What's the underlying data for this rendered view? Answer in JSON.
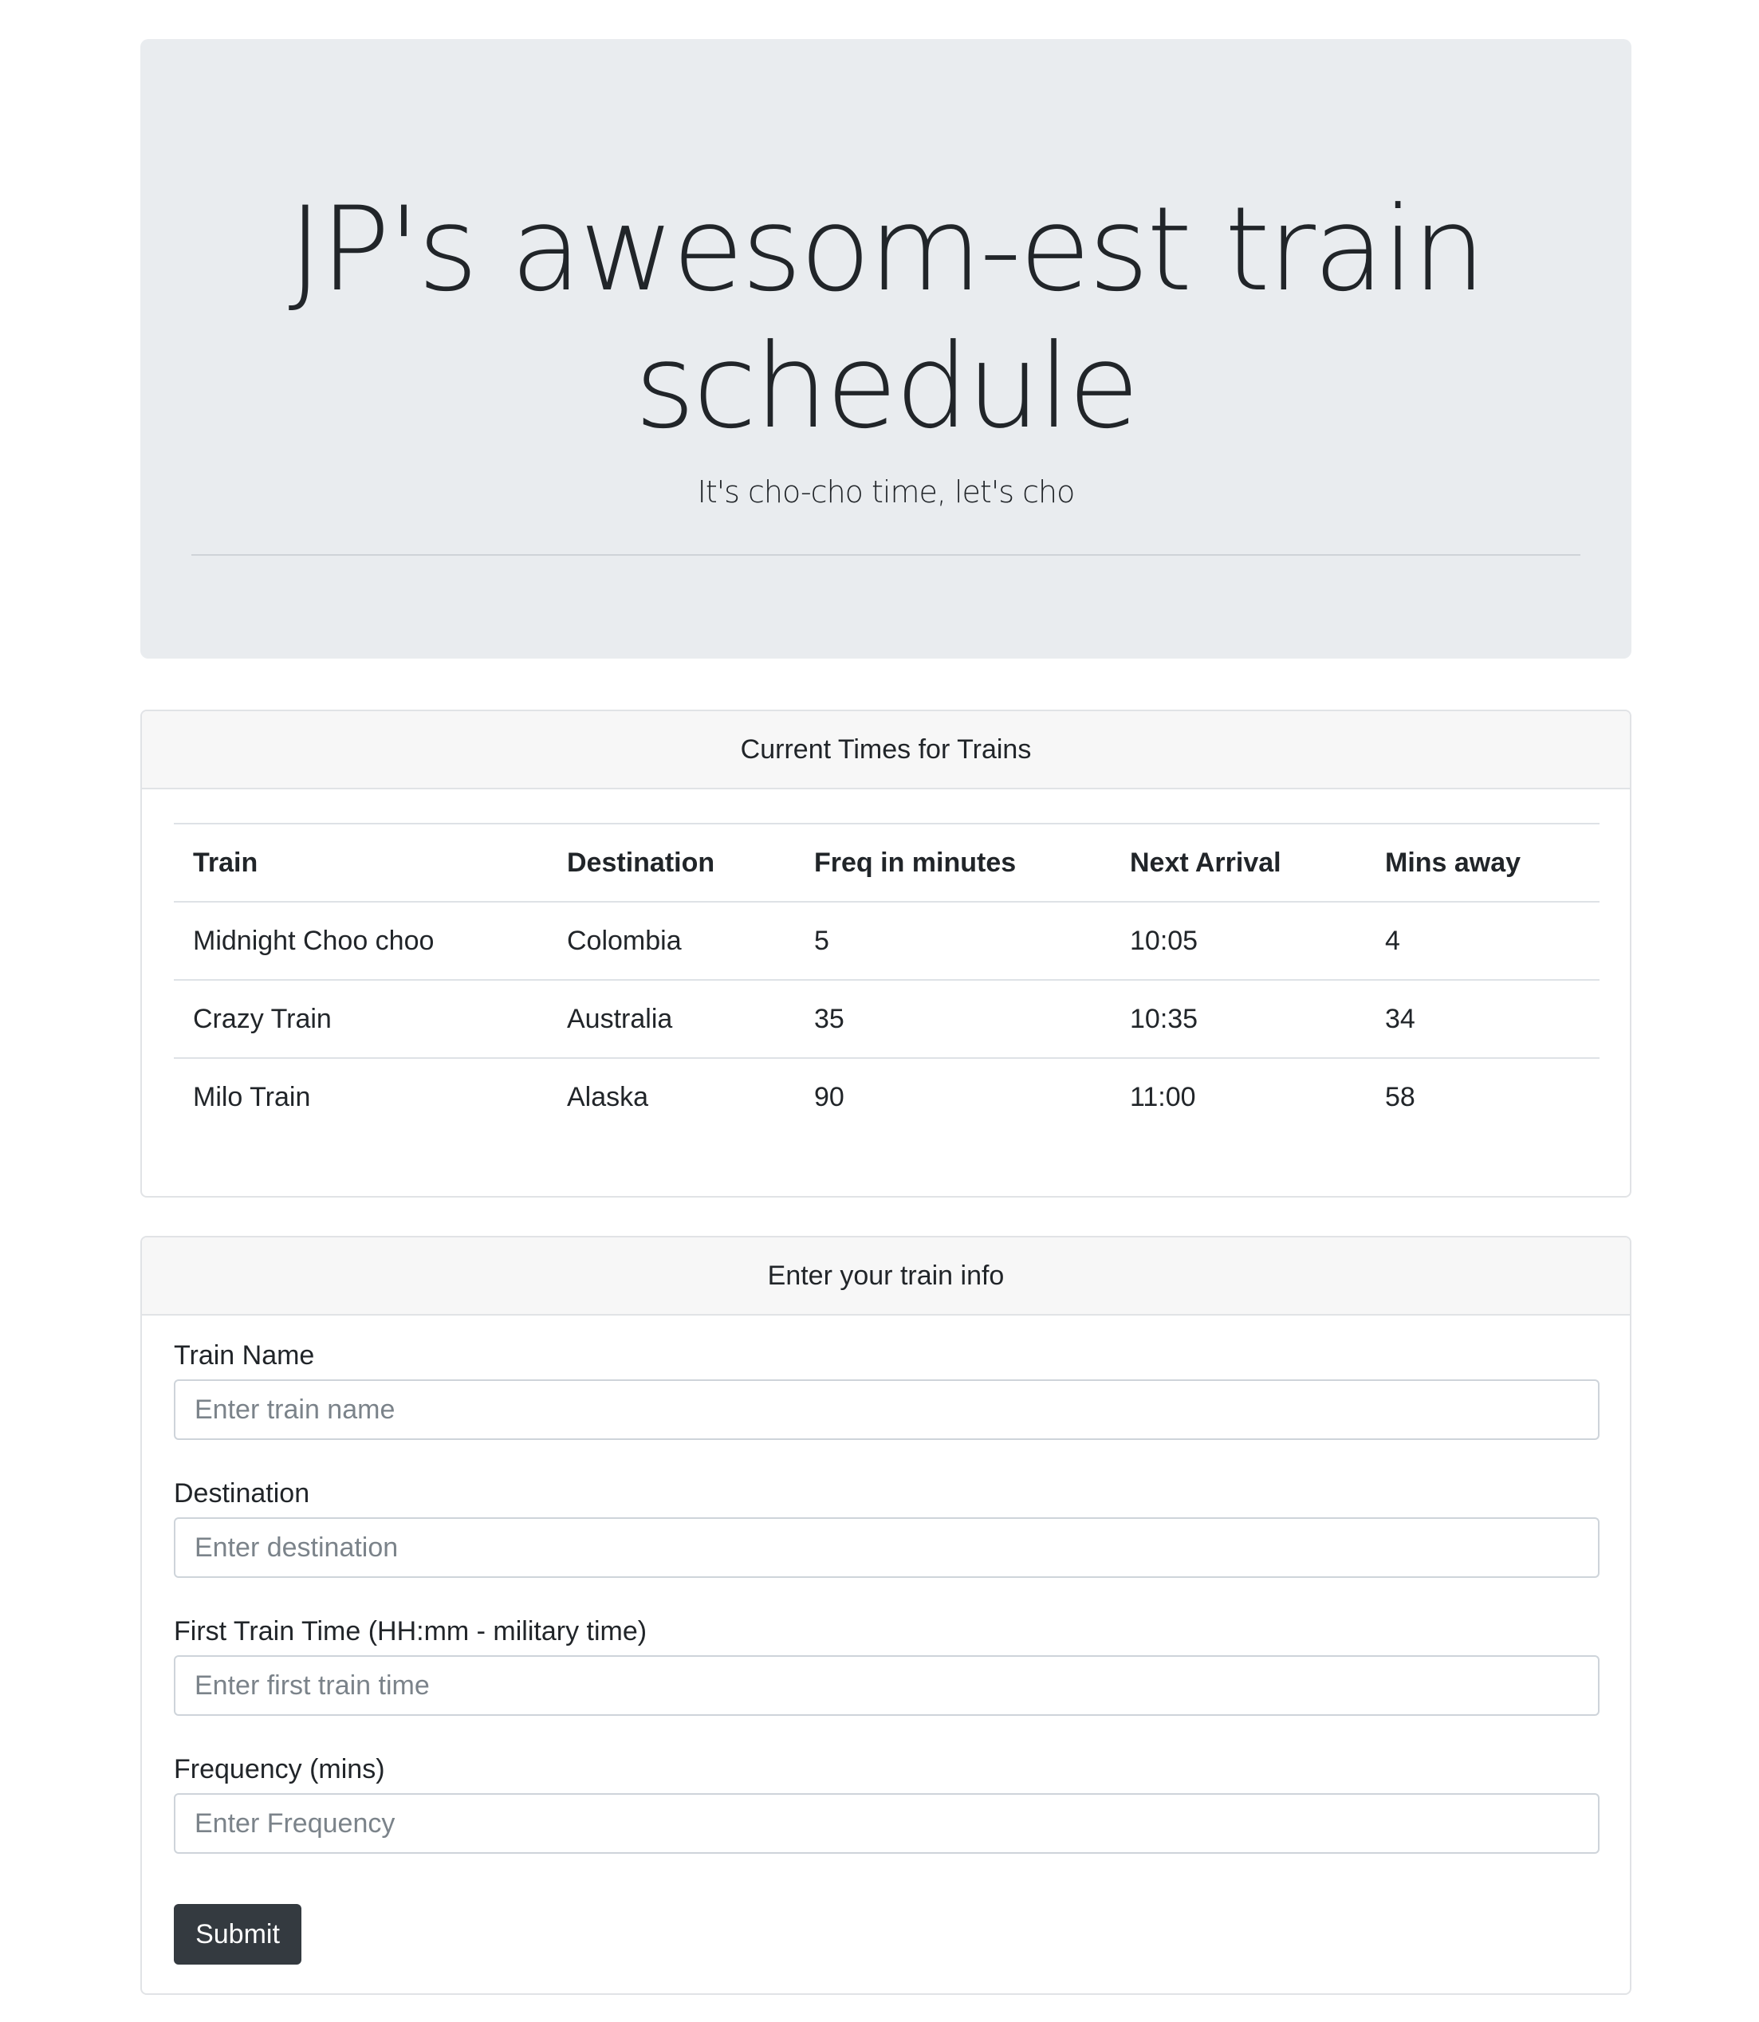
{
  "header": {
    "title_line1": "JP's awesom-est train",
    "title_line2": "schedule",
    "lead": "It's cho-cho time, let's cho"
  },
  "schedule": {
    "card_title": "Current Times for Trains",
    "columns": [
      "Train",
      "Destination",
      "Freq in minutes",
      "Next Arrival",
      "Mins away"
    ],
    "rows": [
      [
        "Midnight Choo choo",
        "Colombia",
        "5",
        "10:05",
        "4"
      ],
      [
        "Crazy Train",
        "Australia",
        "35",
        "10:35",
        "34"
      ],
      [
        "Milo Train",
        "Alaska",
        "90",
        "11:00",
        "58"
      ]
    ]
  },
  "form": {
    "card_title": "Enter your train info",
    "fields": [
      {
        "label": "Train Name",
        "placeholder": "Enter train name",
        "value": ""
      },
      {
        "label": "Destination",
        "placeholder": "Enter destination",
        "value": ""
      },
      {
        "label": "First Train Time (HH:mm - military time)",
        "placeholder": "Enter first train time",
        "value": ""
      },
      {
        "label": "Frequency (mins)",
        "placeholder": "Enter Frequency",
        "value": ""
      }
    ],
    "submit_label": "Submit"
  },
  "colors": {
    "jumbotron_bg": "#e9ecef",
    "card_header_bg": "#f7f7f7",
    "button_bg": "#343a40",
    "text": "#212529"
  }
}
